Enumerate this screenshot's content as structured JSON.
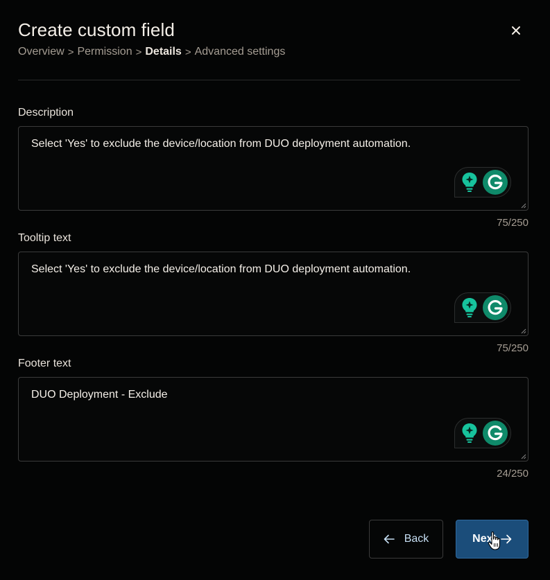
{
  "dialog": {
    "title": "Create custom field",
    "close_icon": "close-icon"
  },
  "breadcrumb": {
    "items": [
      {
        "label": "Overview",
        "current": false
      },
      {
        "label": "Permission",
        "current": false
      },
      {
        "label": "Details",
        "current": true
      },
      {
        "label": "Advanced settings",
        "current": false
      }
    ],
    "separator": ">"
  },
  "fields": {
    "description": {
      "label": "Description",
      "value": "Select 'Yes' to exclude the device/location from DUO deployment automation.",
      "counter": "75/250"
    },
    "tooltip": {
      "label": "Tooltip text",
      "value": "Select 'Yes' to exclude the device/location from DUO deployment automation.",
      "counter": "75/250"
    },
    "footer": {
      "label": "Footer text",
      "value": "DUO Deployment - Exclude",
      "counter": "24/250"
    }
  },
  "buttons": {
    "back_label": "Back",
    "next_label": "Next"
  },
  "colors": {
    "background": "#040505",
    "primary_button": "#1b4d7a",
    "grammarly_green": "#0f8a6a",
    "bulb_teal": "#17c39d"
  }
}
